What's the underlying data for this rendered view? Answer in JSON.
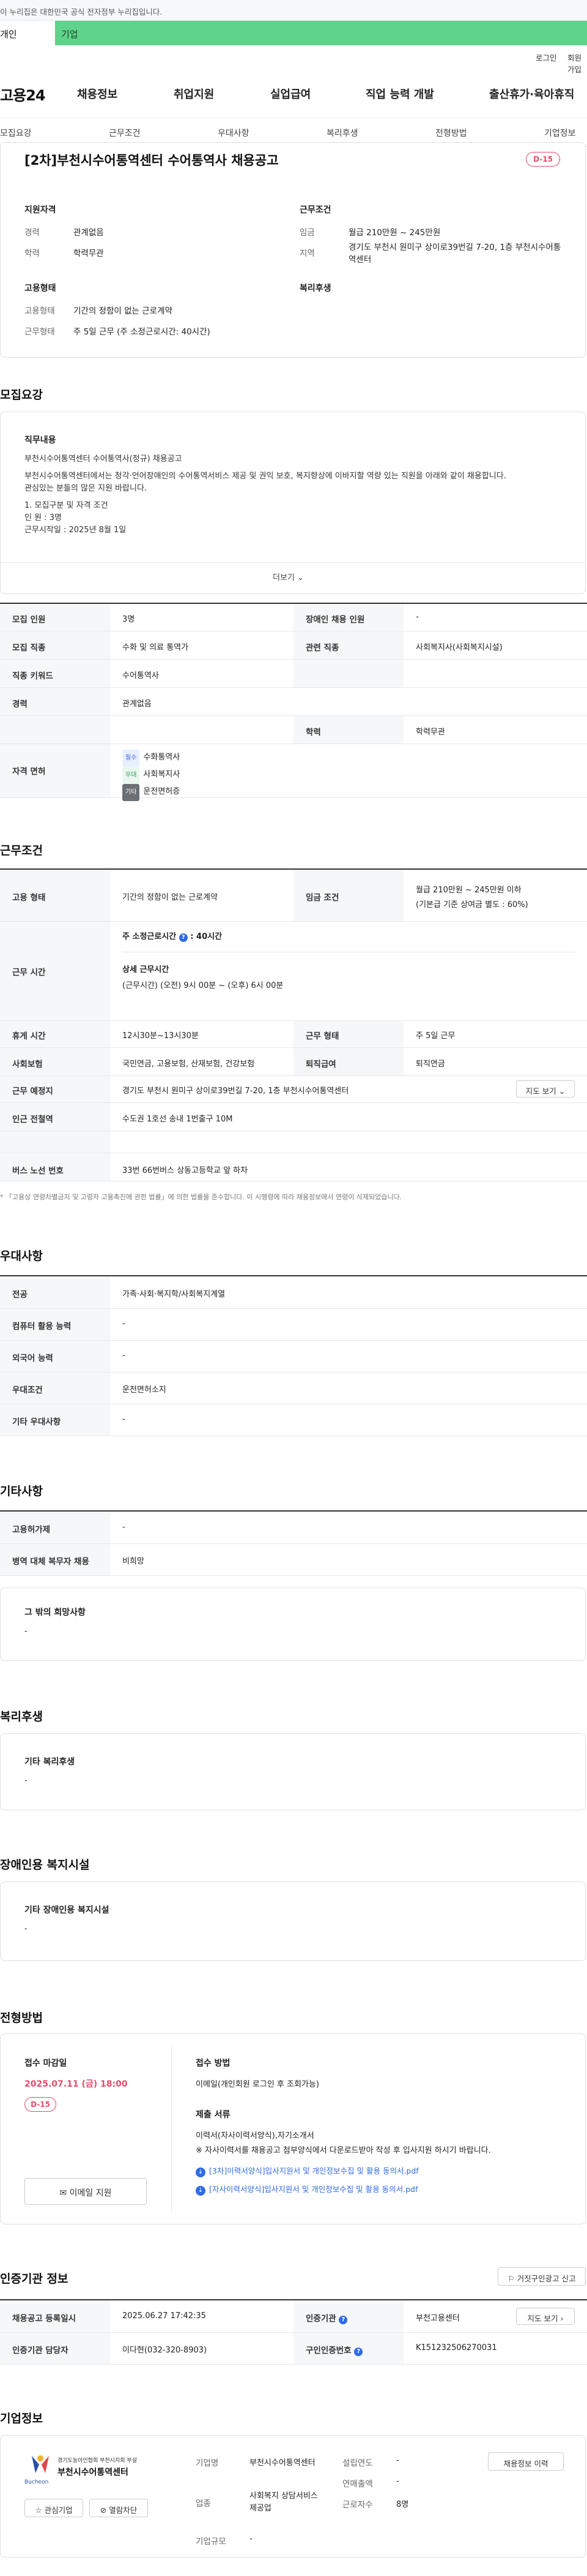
{
  "gov_banner": "이 누리집은 대한민국 공식 전자정부 누리집입니다.",
  "audience_tabs": {
    "personal": "개인",
    "business": "기업"
  },
  "util_nav": {
    "login": "로그인",
    "signup": "회원가입"
  },
  "logo": "고용24",
  "gnb": [
    "채용정보",
    "취업지원",
    "실업급여",
    "직업 능력 개발",
    "출산휴가·육아휴직"
  ],
  "lnb": [
    "모집요강",
    "근무조건",
    "우대사항",
    "복리후생",
    "전형방법",
    "기업정보"
  ],
  "job": {
    "title": "[2차]부천시수어통역센터 수어통역사 채용공고",
    "dday": "D-15",
    "summary": {
      "qualification_h": "지원자격",
      "career_k": "경력",
      "career_v": "관계없음",
      "education_k": "학력",
      "education_v": "학력무관",
      "employment_h": "고용형태",
      "emptype_k": "고용형태",
      "emptype_v": "기간의 정함이 없는 근로계약",
      "worktype_k": "근무형태",
      "worktype_v": "주 5일 근무 (주 소정근로시간: 40시간)",
      "conditions_h": "근무조건",
      "wage_k": "임금",
      "wage_v": "월급 210만원 ~ 245만원",
      "area_k": "지역",
      "area_v": "경기도 부천시 원미구 상이로39번길 7-20, 1층 부천시수어통역센터",
      "welfare_h": "복리후생"
    }
  },
  "recruit": {
    "heading": "모집요강",
    "duty_h": "직무내용",
    "duty_lines": [
      "부천시수어통역센터 수어통역사(정규) 채용공고",
      "",
      "부천시수어통역센터에서는 청각·언어장애인의 수어통역서비스 제공 및 권익 보호, 복지향상에 이바지할 역량 있는 직원을 아래와 같이 채용합니다.",
      "관심있는 분들의 많은 지원 바랍니다.",
      "",
      "1. 모집구분 및 자격 조건",
      " 인 원 : 3명",
      " 근무시작일 : 2025년 8월 1일"
    ],
    "more": "더보기",
    "rows": {
      "headcount_k": "모집 인원",
      "headcount_v": "3명",
      "disabled_k": "장애인 채용 인원",
      "disabled_v": "-",
      "job_k": "모집 직종",
      "job_v": "수화 및 의료 통역가",
      "related_k": "관련 직종",
      "related_v": "사회복지사(사회복지시설)",
      "keyword_k": "직종 키워드",
      "keyword_v": "수어통역사",
      "career_k": "경력",
      "career_v": "관계없음",
      "edu_k": "학력",
      "edu_v": "학력무관",
      "license_k": "자격 면허",
      "licenses": [
        {
          "badge": "필수",
          "name": "수화통역사"
        },
        {
          "badge": "우대",
          "name": "사회복지사"
        },
        {
          "badge": "기타",
          "name": "운전면허증"
        }
      ]
    }
  },
  "work": {
    "heading": "근무조건",
    "emptype_k": "고용 형태",
    "emptype_v": "기간의 정함이 없는 근로계약",
    "wage_k": "임금 조건",
    "wage_v1": "월급 210만원 ~ 245만원 이하",
    "wage_v2": "(기본급 기준 상여금 별도 : 60%)",
    "hours_k": "근무 시간",
    "hours_weekly_label": "주 소정근로시간",
    "hours_weekly_value": "40시간",
    "hours_detail_h": "상세 근무시간",
    "hours_detail_v": "(근무시간) (오전) 9시 00분 ~ (오후) 6시 00분",
    "break_k": "휴게 시간",
    "break_v": "12시30분~13시30분",
    "worktype_k": "근무 형태",
    "worktype_v": "주 5일 근무",
    "insurance_k": "사회보험",
    "insurance_v": "국민연금, 고용보험, 산재보험, 건강보험",
    "severance_k": "퇴직급여",
    "severance_v": "퇴직연금",
    "place_k": "근무 예정지",
    "place_v": "경기도 부천시 원미구 상이로39번길 7-20, 1층 부천시수어통역센터",
    "map_btn": "지도 보기",
    "station_k": "인근 전철역",
    "station_v": "수도권 1호선 송내 1번출구 10M",
    "bus_k": "버스 노선 번호",
    "bus_v": "33번 66번버스 상동고등학교 앞 하차",
    "notice": "* 「고용상 연령차별금지 및 고령자 고용촉진에 관한 법률」에 의한 법률을 준수합니다. 이 시행령에 따라 채용정보에서 연령이 삭제되었습니다."
  },
  "pref": {
    "heading": "우대사항",
    "major_k": "전공",
    "major_v": "가족·사회·복지학/사회복지계열",
    "computer_k": "컴퓨터 활용 능력",
    "computer_v": "-",
    "lang_k": "외국어 능력",
    "lang_v": "-",
    "cond_k": "우대조건",
    "cond_v": "운전면허소지",
    "etc_k": "기타 우대사항",
    "etc_v": "-"
  },
  "other": {
    "heading": "기타사항",
    "insurance_k": "고용허가제",
    "insurance_v": "-",
    "military_k": "병역 대체 복무자 채용",
    "military_v": "비희망",
    "hope_h": "그 밖의 희망사항",
    "hope_v": "-"
  },
  "welfare": {
    "heading": "복리후생",
    "box_h": "기타 복리후생",
    "box_v": "-"
  },
  "disabled": {
    "heading": "장애인용 복지시설",
    "box_h": "기타 장애인용 복지시설",
    "box_v": "-"
  },
  "selection": {
    "heading": "전형방법",
    "deadline_h": "접수 마감일",
    "deadline_v": "2025.07.11 (금) 18:00",
    "dday": "D-15",
    "email_btn": "이메일 지원",
    "method_h": "접수 방법",
    "method_v": "이메일(개인회원 로그인 후 조회가능)",
    "docs_h": "제출 서류",
    "docs_lines": [
      "이력서(자사이력서양식),자기소개서",
      "※ 자사이력서를 채용공고 첨부양식에서 다운로드받아 작성 후 입사지원 하시기 바랍니다."
    ],
    "files": [
      "[3차]이력서양식]입사지원서 및 개인정보수집 및 활용 동의서.pdf",
      "[자사이력서양식]입사지원서 및 개인정보수집 및 활용 동의서.pdf"
    ]
  },
  "cert": {
    "heading": "인증기관 정보",
    "report_btn": "거짓구인광고 신고",
    "reg_k": "채용공고 등록일시",
    "reg_v": "2025.06.27 17:42:35",
    "agency_k": "인증기관",
    "agency_v": "부천고용센터",
    "agency_btn": "지도 보기",
    "manager_k": "인증기관 담당자",
    "manager_v": "이다현(032-320-8903)",
    "job_no_k": "구인인증번호",
    "job_no_v": "K151232506270031"
  },
  "company": {
    "heading": "기업정보",
    "logo_line1": "경기도농아인협회 부천시지회 부설",
    "logo_line2": "부천시수어통역센터",
    "logo_word": "Bucheon",
    "interest_btn": "관심기업",
    "block_btn": "열람차단",
    "name_k": "기업명",
    "name_v": "부천시수어통역센터",
    "industry_k": "업종",
    "industry_v": "사회복지 상담서비스 제공업",
    "scale_k": "기업규모",
    "scale_v": "-",
    "founded_k": "설립연도",
    "founded_v": "-",
    "sales_k": "연매출액",
    "sales_v": "-",
    "staff_k": "근로자수",
    "staff_v": "8명",
    "history_btn": "채용정보 이력"
  }
}
